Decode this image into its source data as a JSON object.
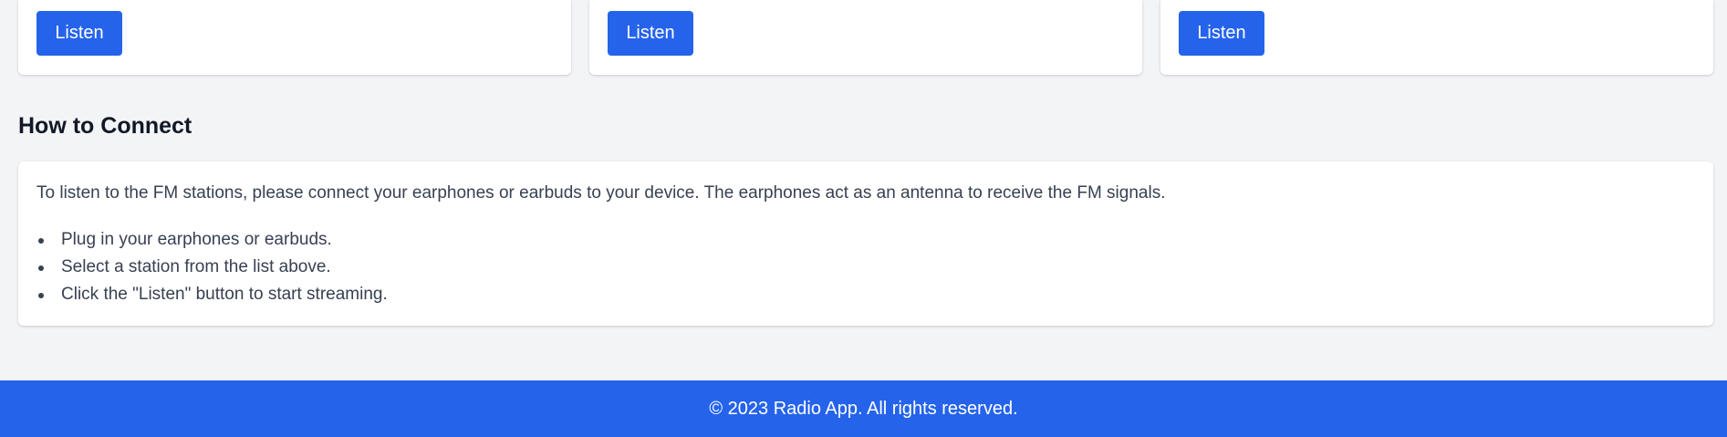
{
  "stations": {
    "cards": [
      {
        "button_label": "Listen"
      },
      {
        "button_label": "Listen"
      },
      {
        "button_label": "Listen"
      }
    ]
  },
  "how_to_connect": {
    "title": "How to Connect",
    "intro": "To listen to the FM stations, please connect your earphones or earbuds to your device. The earphones act as an antenna to receive the FM signals.",
    "steps": [
      "Plug in your earphones or earbuds.",
      "Select a station from the list above.",
      "Click the \"Listen\" button to start streaming."
    ]
  },
  "footer": {
    "text": "© 2023 Radio App. All rights reserved."
  },
  "colors": {
    "accent": "#2563eb",
    "background": "#f3f4f6",
    "card": "#ffffff",
    "heading": "#111827",
    "body_text": "#374151"
  }
}
